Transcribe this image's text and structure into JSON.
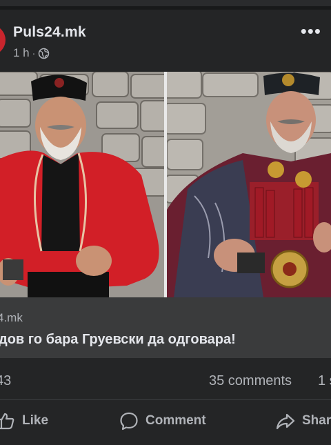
{
  "post": {
    "page_name": "Puls24.mk",
    "time": "1 h",
    "separator": "·",
    "privacy_icon": "globe-icon",
    "more_label": "•••",
    "avatar_color": "#c9252d"
  },
  "link_preview": {
    "domain": "4.mk",
    "title": "дов го бара Груевски да одговара!"
  },
  "stats": {
    "reactions": "43",
    "comments": "35 comments",
    "shares": "1 s"
  },
  "actions": {
    "like": "Like",
    "comment": "Comment",
    "share": "Shar"
  },
  "colors": {
    "background": "#18191a",
    "card": "#242526",
    "preview": "#3a3b3c",
    "text_primary": "#e4e6eb",
    "text_secondary": "#b0b3b8"
  }
}
